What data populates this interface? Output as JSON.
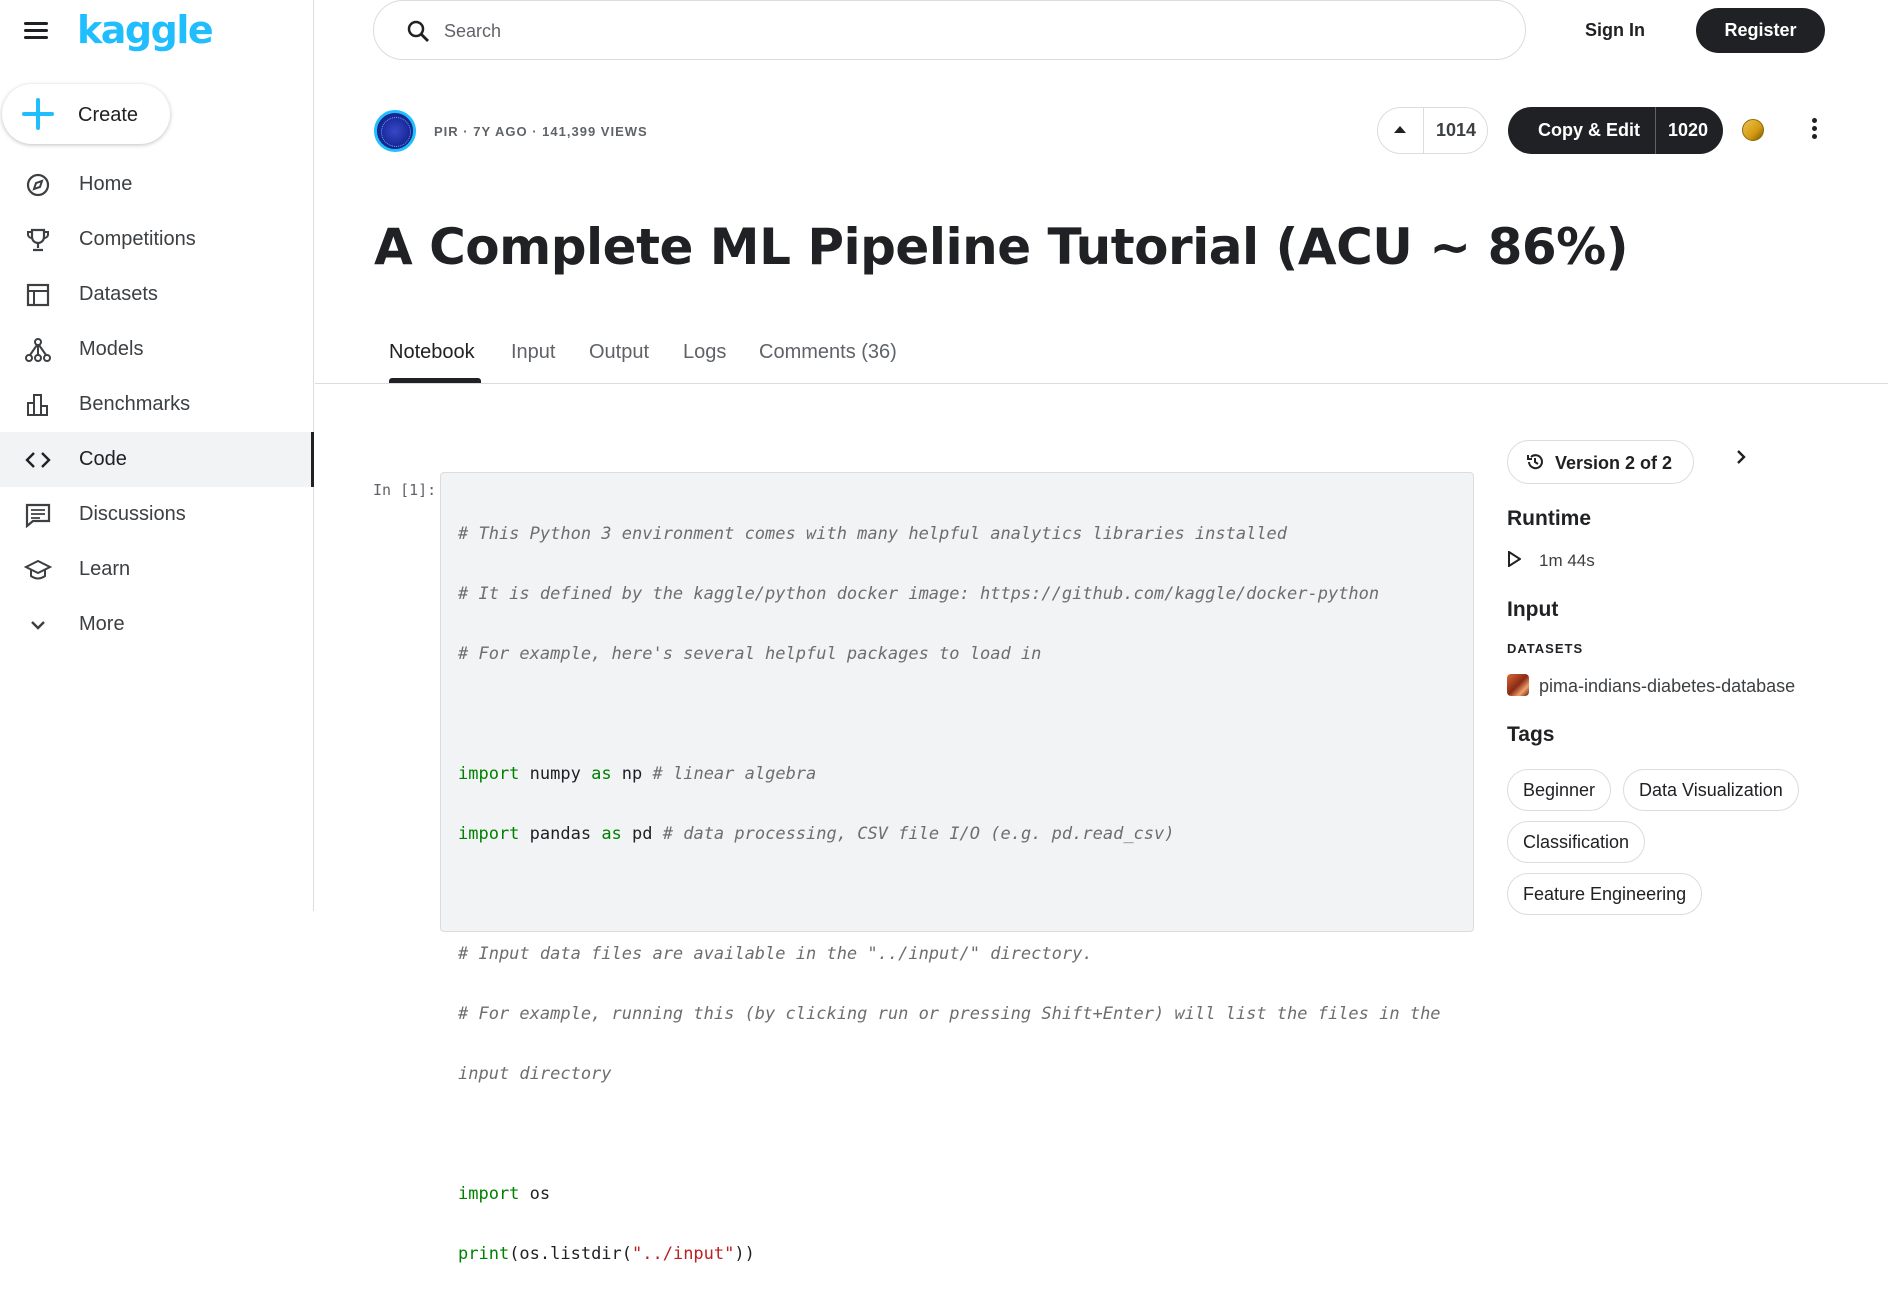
{
  "app": {
    "logo": "kaggle"
  },
  "header": {
    "search_placeholder": "Search",
    "sign_in": "Sign In",
    "register": "Register"
  },
  "sidebar": {
    "create": "Create",
    "items": [
      {
        "label": "Home",
        "icon": "compass-icon"
      },
      {
        "label": "Competitions",
        "icon": "trophy-icon"
      },
      {
        "label": "Datasets",
        "icon": "table-icon"
      },
      {
        "label": "Models",
        "icon": "models-icon"
      },
      {
        "label": "Benchmarks",
        "icon": "bar-chart-icon"
      },
      {
        "label": "Code",
        "icon": "code-icon",
        "active": true
      },
      {
        "label": "Discussions",
        "icon": "comment-icon"
      },
      {
        "label": "Learn",
        "icon": "school-icon"
      },
      {
        "label": "More",
        "icon": "chevron-down-icon"
      }
    ]
  },
  "notebook": {
    "meta": "PIR · 7Y AGO · 141,399 VIEWS",
    "votes": "1014",
    "copy_edit": "Copy & Edit",
    "copy_count": "1020",
    "title": "A Complete ML Pipeline Tutorial (ACU ~ 86%)",
    "tabs": [
      "Notebook",
      "Input",
      "Output",
      "Logs",
      "Comments (36)"
    ],
    "active_tab": "Notebook"
  },
  "cell": {
    "prompt": "In [1]:",
    "code_lines": [
      "# This Python 3 environment comes with many helpful analytics libraries installed",
      "# It is defined by the kaggle/python docker image: https://github.com/kaggle/docker-python",
      "# For example, here's several helpful packages to load in",
      "",
      "import numpy as np # linear algebra",
      "import pandas as pd # data processing, CSV file I/O (e.g. pd.read_csv)",
      "",
      "# Input data files are available in the \"../input/\" directory.",
      "# For example, running this (by clicking run or pressing Shift+Enter) will list the files in the",
      "input directory",
      "",
      "import os",
      "print(os.listdir(\"../input\"))"
    ]
  },
  "panel": {
    "version": "Version 2 of 2",
    "runtime_heading": "Runtime",
    "runtime_value": "1m 44s",
    "input_heading": "Input",
    "datasets_heading": "DATASETS",
    "dataset_name": "pima-indians-diabetes-database",
    "tags_heading": "Tags",
    "tags": [
      "Beginner",
      "Data Visualization",
      "Classification",
      "Feature Engineering"
    ]
  },
  "colors": {
    "brand": "#20beff",
    "dark": "#202124",
    "code_bg": "#f1f3f4"
  }
}
